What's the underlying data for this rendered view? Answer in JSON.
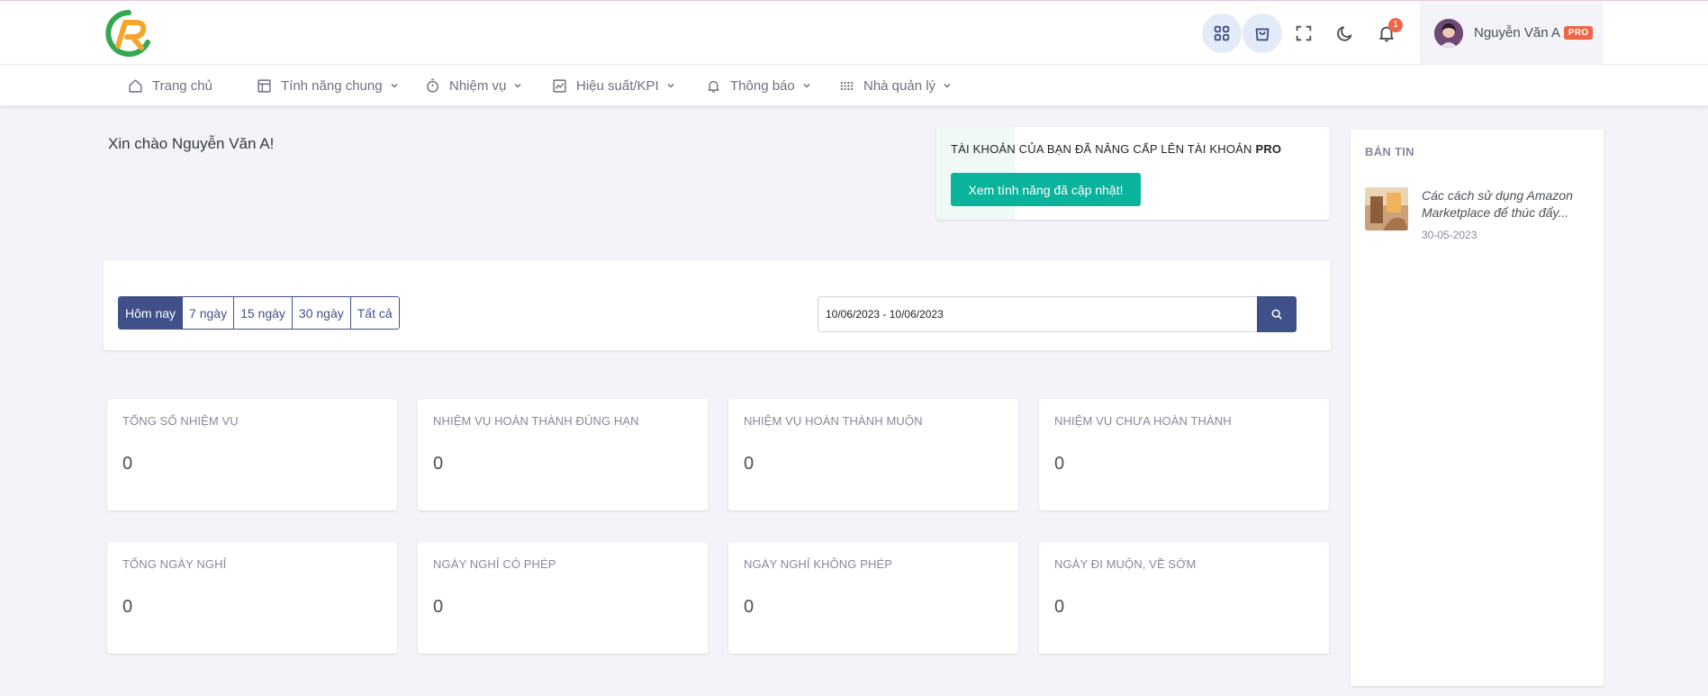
{
  "header": {
    "user_name": "Nguyễn Văn A",
    "pro_badge": "PRO",
    "notification_count": "1",
    "icons": [
      "apps-icon",
      "cart-icon",
      "fullscreen-icon",
      "moon-icon",
      "bell-icon"
    ]
  },
  "nav": {
    "items": [
      {
        "label": "Trang chủ",
        "icon": "home-icon",
        "dropdown": false
      },
      {
        "label": "Tính năng chung",
        "icon": "table-icon",
        "dropdown": true
      },
      {
        "label": "Nhiệm vụ",
        "icon": "timer-icon",
        "dropdown": true
      },
      {
        "label": "Hiệu suất/KPI",
        "icon": "chart-icon",
        "dropdown": true
      },
      {
        "label": "Thông báo",
        "icon": "bell-icon",
        "dropdown": true
      },
      {
        "label": "Nhà quản lý",
        "icon": "grid-dots-icon",
        "dropdown": true
      }
    ]
  },
  "greeting": "Xin chào Nguyễn Văn A!",
  "pro_card": {
    "text_prefix": "TÀI KHOẢN CỦA BẠN ĐÃ NÂNG CẤP LÊN TÀI KHOẢN",
    "text_strong": "PRO",
    "button_label": "Xem tính năng đã cập nhật!"
  },
  "news": {
    "title": "BẢN TIN",
    "items": [
      {
        "headline": "Các cách sử dụng Amazon Marketplace để thúc đẩy...",
        "date": "30-05-2023"
      }
    ]
  },
  "filter": {
    "ranges": [
      "Hôm nay",
      "7 ngày",
      "15 ngày",
      "30 ngày",
      "Tất cả"
    ],
    "active_index": 0,
    "date_range_value": "10/06/2023 - 10/06/2023"
  },
  "stats_row1": [
    {
      "label": "TỔNG SỐ NHIỆM VỤ",
      "value": "0"
    },
    {
      "label": "NHIỆM VỤ HOÀN THÀNH ĐÚNG HẠN",
      "value": "0"
    },
    {
      "label": "NHIỆM VỤ HOÀN THÀNH MUỘN",
      "value": "0"
    },
    {
      "label": "NHIỆM VỤ CHƯA HOÀN THÀNH",
      "value": "0"
    }
  ],
  "stats_row2": [
    {
      "label": "TỔNG NGÀY NGHỈ",
      "value": "0"
    },
    {
      "label": "NGÀY NGHỈ CÓ PHÉP",
      "value": "0"
    },
    {
      "label": "NGÀY NGHỈ KHÔNG PHÉP",
      "value": "0"
    },
    {
      "label": "NGÀY ĐI MUỘN, VỀ SỚM",
      "value": "0"
    }
  ],
  "colors": {
    "primary": "#405189",
    "success": "#0ab39c",
    "danger": "#f06548",
    "background": "#f3f3f9"
  }
}
